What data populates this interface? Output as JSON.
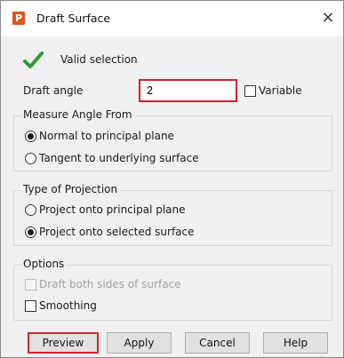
{
  "window": {
    "title": "Draft Surface",
    "app_icon_letter": "P",
    "close_glyph": "×"
  },
  "status": {
    "icon": "check-icon",
    "text": "Valid selection",
    "color": "#1f8a1f"
  },
  "draft_angle": {
    "label": "Draft angle",
    "value": "2",
    "variable_label": "Variable",
    "variable_checked": false
  },
  "measure_group": {
    "legend": "Measure Angle From",
    "options": [
      {
        "label": "Normal to principal plane",
        "checked": true
      },
      {
        "label": "Tangent to underlying surface",
        "checked": false
      }
    ]
  },
  "projection_group": {
    "legend": "Type of Projection",
    "options": [
      {
        "label": "Project onto principal plane",
        "checked": false
      },
      {
        "label": "Project onto selected surface",
        "checked": true
      }
    ]
  },
  "options_group": {
    "legend": "Options",
    "draft_both_sides": {
      "label": "Draft both sides of surface",
      "checked": false,
      "enabled": false
    },
    "smoothing": {
      "label": "Smoothing",
      "checked": false,
      "enabled": true
    }
  },
  "buttons": {
    "preview": "Preview",
    "apply": "Apply",
    "cancel": "Cancel",
    "help": "Help"
  },
  "colors": {
    "highlight": "#d4202a",
    "app_icon": "#e0531e",
    "check": "#2e9b2e"
  }
}
